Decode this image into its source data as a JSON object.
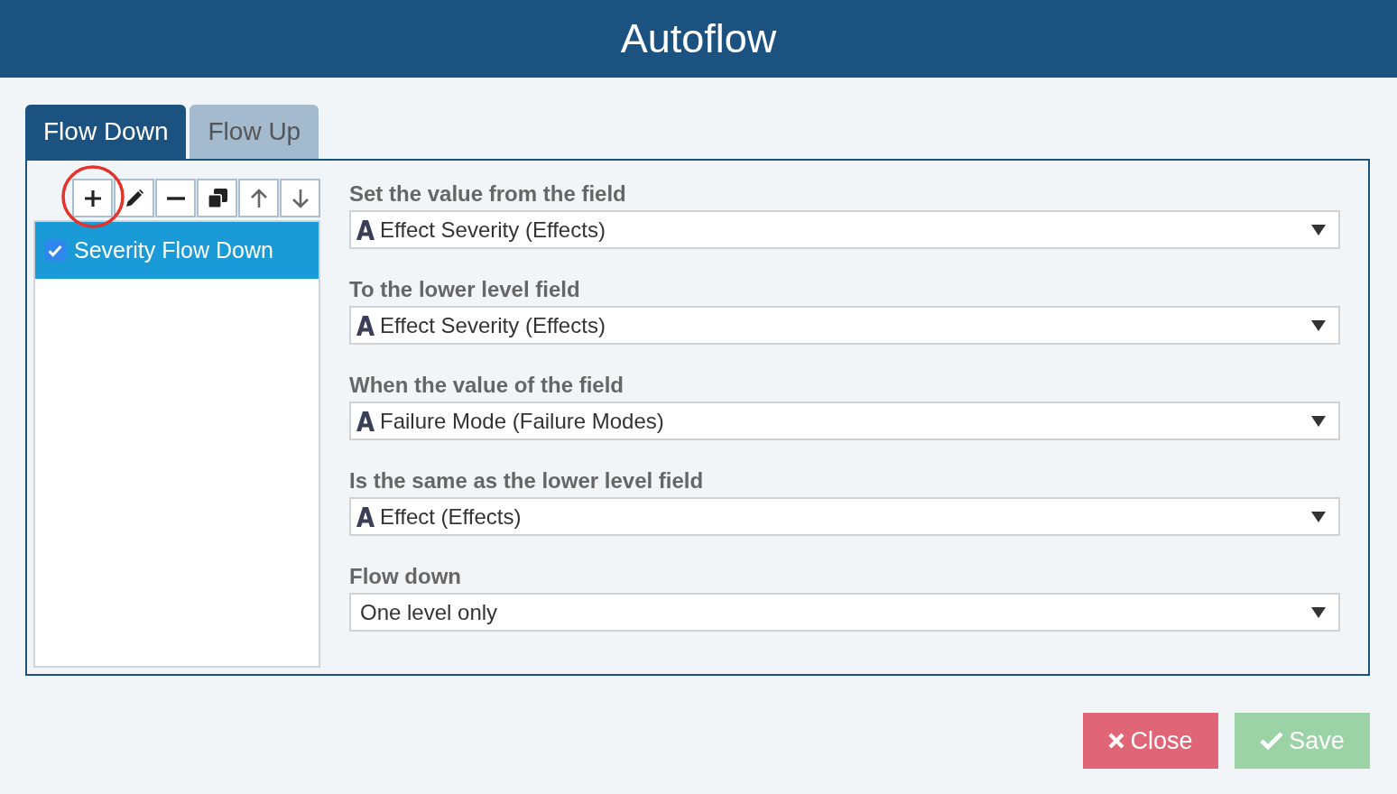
{
  "window": {
    "title": "Autoflow"
  },
  "tabs": [
    {
      "label": "Flow Down",
      "selected": true
    },
    {
      "label": "Flow Up",
      "selected": false
    }
  ],
  "toolbar": [
    {
      "kind": "add",
      "highlighted": true
    },
    {
      "kind": "edit",
      "highlighted": false
    },
    {
      "kind": "remove",
      "highlighted": false
    },
    {
      "kind": "duplicate",
      "highlighted": false
    },
    {
      "kind": "move_up",
      "highlighted": false
    },
    {
      "kind": "move_down",
      "highlighted": false
    }
  ],
  "rules": [
    {
      "label": "Severity Flow Down",
      "checked": true,
      "selected": true
    }
  ],
  "form": [
    {
      "label": "Set the value from the field",
      "kind": "field",
      "value": "Effect Severity (Effects)"
    },
    {
      "label": "To the lower level field",
      "kind": "field",
      "value": "Effect Severity (Effects)"
    },
    {
      "label": "When the value of the field",
      "kind": "field",
      "value": "Failure Mode (Failure Modes)"
    },
    {
      "label": "Is the same as the lower level field",
      "kind": "field",
      "value": "Effect (Effects)"
    },
    {
      "label": "Flow down",
      "kind": "option",
      "value": "One level only"
    }
  ],
  "buttons": [
    {
      "kind": "close",
      "label": "Close"
    },
    {
      "kind": "save",
      "label": "Save"
    }
  ]
}
